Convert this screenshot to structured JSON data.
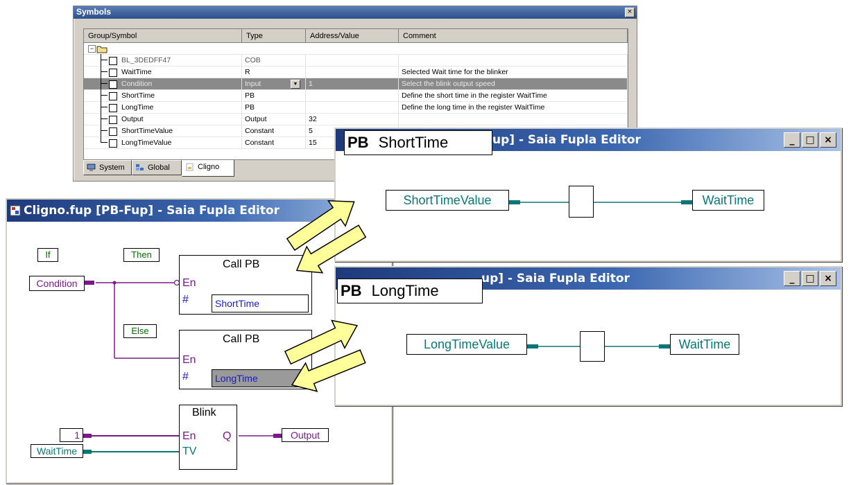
{
  "symbols_window": {
    "title": "Symbols",
    "close": "×",
    "columns": [
      "Group/Symbol",
      "Type",
      "Address/Value",
      "Comment"
    ],
    "rows": [
      {
        "name": "BL_3DEDFF47",
        "type": "COB",
        "value": "",
        "comment": ""
      },
      {
        "name": "WaitTime",
        "type": "R",
        "value": "",
        "comment": "Selected Wait time for the blinker"
      },
      {
        "name": "Condition",
        "type": "Input",
        "value": "1",
        "comment": "Select the blink output speed"
      },
      {
        "name": "ShortTime",
        "type": "PB",
        "value": "",
        "comment": "Define the short time in the register WaitTime"
      },
      {
        "name": "LongTime",
        "type": "PB",
        "value": "",
        "comment": "Define the long time in the register WaitTime"
      },
      {
        "name": "Output",
        "type": "Output",
        "value": "32",
        "comment": ""
      },
      {
        "name": "ShortTimeValue",
        "type": "Constant",
        "value": "5",
        "comment": ""
      },
      {
        "name": "LongTimeValue",
        "type": "Constant",
        "value": "15",
        "comment": ""
      }
    ],
    "dropdown_arrow": "▼",
    "tabs": [
      "System",
      "Global",
      "Cligno"
    ]
  },
  "main_editor": {
    "title": "Cligno.fup [PB-Fup] - Saia Fupla Editor",
    "labels": {
      "if": "If",
      "then": "Then",
      "else": "Else"
    },
    "condition": "Condition",
    "call1": {
      "title": "Call PB",
      "en": "En",
      "hash": "#",
      "target": "ShortTime"
    },
    "call2": {
      "title": "Call PB",
      "en": "En",
      "hash": "#",
      "target": "LongTime"
    },
    "blink": {
      "title": "Blink",
      "en": "En",
      "q": "Q",
      "tv": "TV"
    },
    "const_one": "1",
    "waittime": "WaitTime",
    "output": "Output"
  },
  "short_editor": {
    "title": "up] - Saia Fupla Editor",
    "pb": "PB",
    "name": "ShortTime",
    "input": "ShortTimeValue",
    "output": "WaitTime"
  },
  "long_editor": {
    "title": "up] - Saia Fupla Editor",
    "pb": "PB",
    "name": "LongTime",
    "input": "LongTimeValue",
    "output": "WaitTime"
  },
  "window_buttons": {
    "minimize": "_",
    "maximize": "□",
    "close": "×"
  },
  "colors": {
    "arrow_fill": "#ffff99",
    "wire_purple": "#7a1a8a",
    "wire_teal": "#0a7777",
    "title_blue": "#1e3a7b"
  }
}
